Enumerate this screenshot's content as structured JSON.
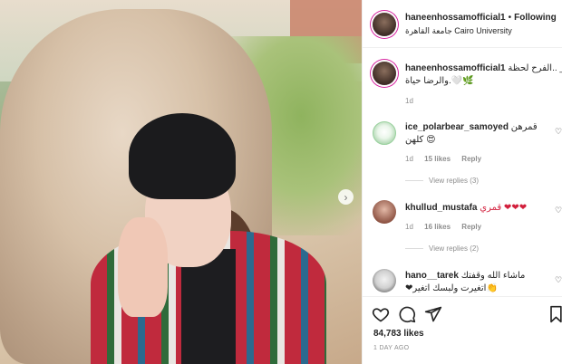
{
  "post": {
    "username": "haneenhossamofficial1",
    "follow_label": "Following",
    "location": "جامعة القاهرة Cairo University"
  },
  "caption": {
    "username": "haneenhossamofficial1",
    "line1": "الفرح لحظة.. __",
    "line2": "والرضا حياة.🤍🌿",
    "time": "1d"
  },
  "comments": [
    {
      "username": "ice_polarbear_samoyed",
      "text1": "قمرهن",
      "text2": "كلهن 😍",
      "time": "1d",
      "likes": "15 likes",
      "reply": "Reply",
      "view_replies": "View replies (3)"
    },
    {
      "username": "khullud_mustafa",
      "text1": "قمري ❤❤❤",
      "time": "1d",
      "likes": "16 likes",
      "reply": "Reply",
      "view_replies": "View replies (2)"
    },
    {
      "username": "hano__tarek",
      "text1": "ماشاء الله وقفتك",
      "text2": "❤اتغيرت ولبسك اتغير👏"
    }
  ],
  "likes_count": "84,783 likes",
  "posted": "1 DAY AGO",
  "icons": {
    "next": "chevron-right-icon",
    "like": "heart-outline-icon",
    "comment": "comment-bubble-icon",
    "share": "paper-plane-icon",
    "save": "bookmark-icon",
    "comment_like": "small-heart-icon"
  }
}
